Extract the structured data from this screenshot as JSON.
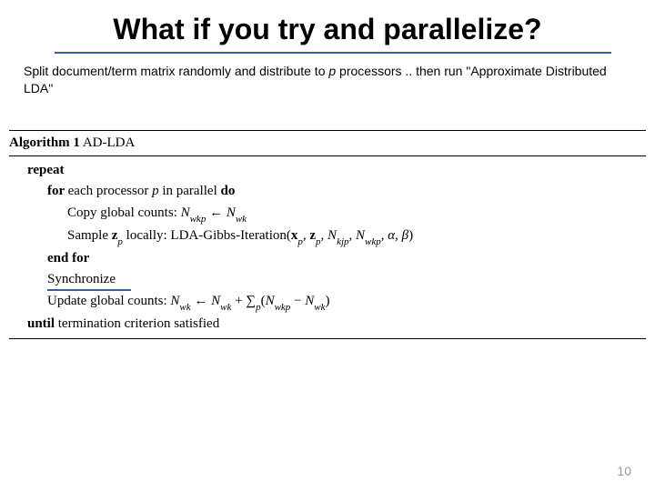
{
  "title": "What if you try and parallelize?",
  "subtitle_part1": "Split document/term matrix randomly and distribute to ",
  "subtitle_p": "p",
  "subtitle_part2": " processors .. then run \"Approximate Distributed LDA\"",
  "algo": {
    "label_prefix": "Algorithm 1",
    "label_name": " AD-LDA",
    "repeat": "repeat",
    "for_prefix": "for ",
    "for_text": "each processor ",
    "for_p": "p",
    "for_mid": " in parallel ",
    "do": "do",
    "copy_prefix": "Copy global counts: ",
    "copy_lhs": "N",
    "copy_lhs_sub": "wkp",
    "copy_arrow": " ← ",
    "copy_rhs": "N",
    "copy_rhs_sub": "wk",
    "sample_prefix": "Sample ",
    "sample_z": "z",
    "sample_z_sub": "p",
    "sample_mid": " locally: LDA-Gibbs-Iteration(",
    "sample_x": "x",
    "sample_x_sub": "p",
    "sample_comma1": ", ",
    "sample_z2": "z",
    "sample_z2_sub": "p",
    "sample_comma2": ", ",
    "sample_n1": "N",
    "sample_n1_sub": "kjp",
    "sample_comma3": ", ",
    "sample_n2": "N",
    "sample_n2_sub": "wkp",
    "sample_comma4": ", ",
    "sample_alpha": "α",
    "sample_comma5": ", ",
    "sample_beta": "β",
    "sample_close": ")",
    "endfor": "end for",
    "sync": "Synchronize",
    "update_prefix": "Update global counts: ",
    "update_lhs": "N",
    "update_lhs_sub": "wk",
    "update_arrow": " ← ",
    "update_rhs1": "N",
    "update_rhs1_sub": "wk",
    "update_plus": " + ",
    "update_sum": "∑",
    "update_sum_sub": "p",
    "update_paren_open": "(",
    "update_n1": "N",
    "update_n1_sub": "wkp",
    "update_minus": " − ",
    "update_n2": "N",
    "update_n2_sub": "wk",
    "update_paren_close": ")",
    "until_prefix": "until ",
    "until_text": "termination criterion satisfied"
  },
  "page_number": "10"
}
